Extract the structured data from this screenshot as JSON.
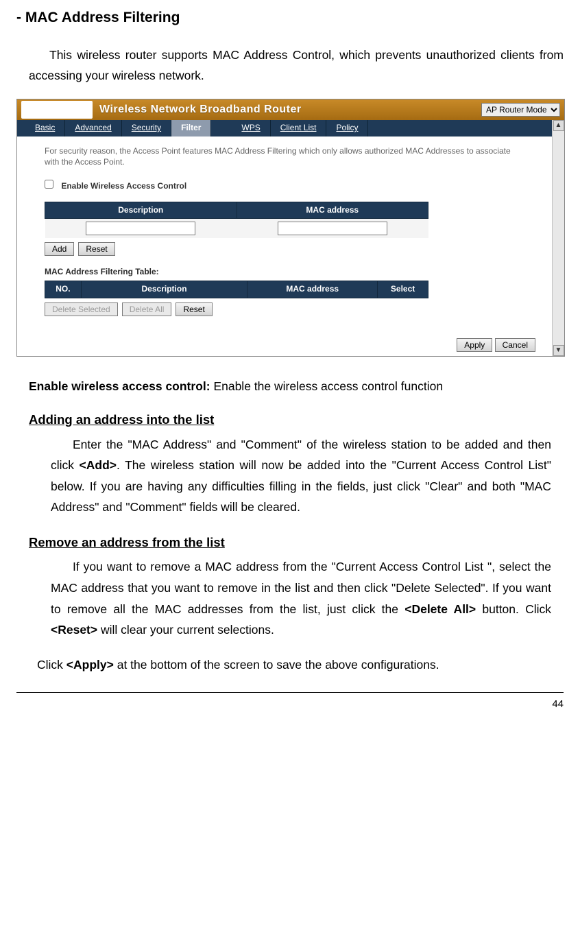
{
  "doc": {
    "heading": "- MAC Address Filtering",
    "intro": "This wireless router supports MAC Address Control, which prevents unauthorized clients from accessing your wireless network.",
    "enable_label": "Enable wireless access control:",
    "enable_text": " Enable the wireless access control function",
    "add_heading": "Adding an address into the list",
    "add_para_pre": "Enter the \"MAC Address\" and \"Comment\" of the wireless station to be added and then click ",
    "add_bold": "<Add>",
    "add_para_post": ". The wireless station will now be added into the \"Current Access Control List\" below. If you are having any difficulties filling in the fields, just click \"Clear\" and both \"MAC Address\" and \"Comment\" fields will be cleared.",
    "remove_heading": "Remove an address from the list",
    "remove_para_pre": "If you want to remove a MAC address from the \"Current Access Control List \", select the MAC address that you want to remove in the list and then click \"Delete Selected\". If you want to remove all the MAC addresses from the list, just click the ",
    "remove_bold1": "<Delete All>",
    "remove_mid": " button. Click ",
    "remove_bold2": "<Reset>",
    "remove_post": " will clear your current selections.",
    "apply_pre": "Click ",
    "apply_bold": "<Apply>",
    "apply_post": " at the bottom of the screen to save the above configurations.",
    "page_number": "44"
  },
  "router": {
    "title": "Wireless Network Broadband Router",
    "mode_option": "AP Router Mode",
    "tabs": [
      "Basic",
      "Advanced",
      "Security",
      "Filter",
      "WPS",
      "Client List",
      "Policy"
    ],
    "active_tab_index": 3,
    "note": "For security reason, the Access Point features MAC Address Filtering which only allows authorized MAC Addresses to associate with the Access Point.",
    "enable_checkbox_label": "Enable Wireless Access Control",
    "entry_headers": {
      "description": "Description",
      "mac": "MAC address"
    },
    "btn_add": "Add",
    "btn_reset": "Reset",
    "filter_table_title": "MAC Address Filtering Table:",
    "filter_headers": {
      "no": "NO.",
      "description": "Description",
      "mac": "MAC address",
      "select": "Select"
    },
    "btn_delete_selected": "Delete Selected",
    "btn_delete_all": "Delete All",
    "btn_reset2": "Reset",
    "btn_apply": "Apply",
    "btn_cancel": "Cancel"
  }
}
